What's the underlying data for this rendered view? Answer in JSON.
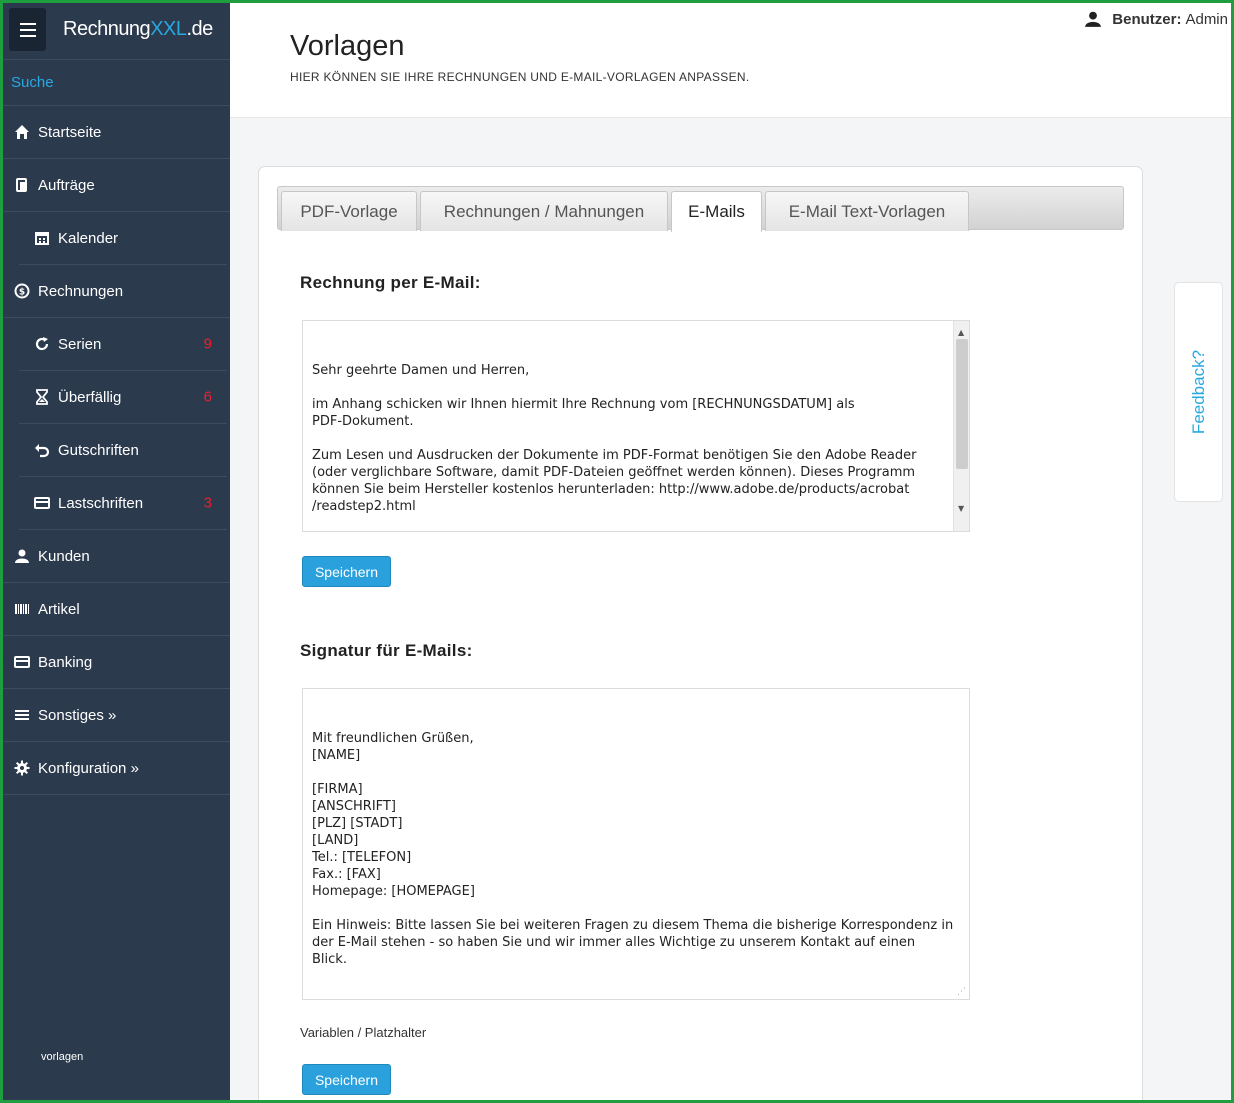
{
  "brand": {
    "part1": "Rechnung",
    "part2": "XXL",
    "part3": ".de"
  },
  "sidebar": {
    "search_label": "Suche",
    "items": [
      {
        "label": "Startseite",
        "icon": "home-icon"
      },
      {
        "label": "Aufträge",
        "icon": "copy-icon"
      },
      {
        "label": "Kalender",
        "icon": "calendar-icon",
        "badge": ""
      },
      {
        "label": "Rechnungen",
        "icon": "dollar-circle-icon"
      },
      {
        "label": "Serien",
        "icon": "refresh-icon",
        "badge": "9"
      },
      {
        "label": "Überfällig",
        "icon": "hourglass-icon",
        "badge": "6"
      },
      {
        "label": "Gutschriften",
        "icon": "undo-icon",
        "badge": ""
      },
      {
        "label": "Lastschriften",
        "icon": "card-icon",
        "badge": "3"
      },
      {
        "label": "Kunden",
        "icon": "user-icon"
      },
      {
        "label": "Artikel",
        "icon": "barcode-icon"
      },
      {
        "label": "Banking",
        "icon": "card-icon"
      },
      {
        "label": "Sonstiges »",
        "icon": "list-icon"
      },
      {
        "label": "Konfiguration »",
        "icon": "gear-icon"
      }
    ],
    "footer": "vorlagen"
  },
  "header": {
    "title": "Vorlagen",
    "subtitle": "HIER KÖNNEN SIE IHRE RECHNUNGEN UND E-MAIL-VORLAGEN ANPASSEN.",
    "user_label": "Benutzer:",
    "user_name": "Admin"
  },
  "tabs": [
    {
      "label": "PDF-Vorlage"
    },
    {
      "label": "Rechnungen / Mahnungen"
    },
    {
      "label": "E-Mails",
      "active": true
    },
    {
      "label": "E-Mail Text-Vorlagen"
    }
  ],
  "invoice_email": {
    "title": "Rechnung per E-Mail:",
    "text": "Sehr geehrte Damen und Herren,\n\nim Anhang schicken wir Ihnen hiermit Ihre Rechnung vom [RECHNUNGSDATUM] als\nPDF-Dokument.\n\nZum Lesen und Ausdrucken der Dokumente im PDF-Format benötigen Sie den Adobe Reader\n(oder verglichbare Software, damit PDF-Dateien geöffnet werden können). Dieses Programm\nkönnen Sie beim Hersteller kostenlos herunterladen: http://www.adobe.de/products/acrobat\n/readstep2.html\n\n\nSie haben weitere Fragen? Gerne sind wir persönlich für Sie da.",
    "save_label": "Speichern"
  },
  "signature": {
    "title": "Signatur für E-Mails:",
    "text": "Mit freundlichen Grüßen,\n[NAME]\n\n[FIRMA]\n[ANSCHRIFT]\n[PLZ] [STADT]\n[LAND]\nTel.: [TELEFON]\nFax.: [FAX]\nHomepage: [HOMEPAGE]\n\nEin Hinweis: Bitte lassen Sie bei weiteren Fragen zu diesem Thema die bisherige Korrespondenz in\nder E-Mail stehen - so haben Sie und wir immer alles Wichtige zu unserem Kontakt auf einen\nBlick.",
    "variables_label": "Variablen / Platzhalter",
    "save_label": "Speichern"
  },
  "feedback_label": "Feedback?",
  "colors": {
    "sidebar_bg": "#2b3a4d",
    "accent": "#29a8e0",
    "badge": "#e8222c",
    "frame": "#1e9e3e"
  }
}
